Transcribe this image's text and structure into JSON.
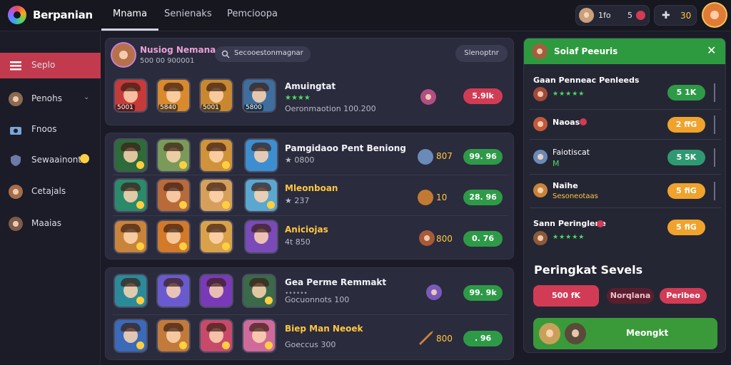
{
  "header": {
    "brand": "Berpanian",
    "tabs": [
      "Mnama",
      "Senienaks",
      "Pemcioopa"
    ],
    "profile_pill": {
      "left": "1fo",
      "right": "5"
    },
    "coins": "30"
  },
  "sidebar": {
    "items": [
      {
        "label": "Seplo"
      },
      {
        "label": "Penohs"
      },
      {
        "label": "Fnoos"
      },
      {
        "label": "Sewaainont"
      },
      {
        "label": "Cetajals"
      },
      {
        "label": "Maaias"
      }
    ]
  },
  "top_panel": {
    "name": "Nusiog Nemana",
    "sub": "500 00 900001",
    "search_placeholder": "Secooestonmagnar",
    "sort_label": "Slenoptnr",
    "tiles": [
      "5001",
      "5840",
      "5001",
      "5800"
    ],
    "item_title": "Amuingtat",
    "item_sub": "Oeronmaotion 100.200",
    "price": "5.9lk"
  },
  "mid_panel": {
    "rows": [
      {
        "title": "Pamgidaoo Pent Beniong",
        "sub": "0800",
        "coin": "807",
        "price": "99. 96"
      },
      {
        "title": "Mleonboan",
        "sub": "237",
        "coin": "10",
        "price": "28. 96"
      },
      {
        "title": "Aniciojas",
        "sub": "4t 850",
        "coin": "800",
        "price": "0. 76"
      }
    ]
  },
  "bot_panel": {
    "rows": [
      {
        "title": "Gea Perme Remmakt",
        "sub": "Gocuonnots 100",
        "price": "99. 9k"
      },
      {
        "title": "Biep Man Neoek",
        "sub": "Goeccus 300",
        "coin": "800",
        "price": ". 96"
      }
    ]
  },
  "right_panel": {
    "title": "Soiaf Peeuris",
    "items": [
      {
        "name": "Gaan Penneac Penleeds",
        "btn": "5 1K",
        "kind": "green"
      },
      {
        "name": "Naoas",
        "btn": "2 ffG",
        "kind": "orange"
      },
      {
        "name": "Faiotiscat",
        "sub": "M",
        "btn": "5 5K",
        "kind": "teal"
      },
      {
        "name": "Naihe",
        "sub": "Sesoneotaas",
        "btn": "5 fiG",
        "kind": "orange"
      },
      {
        "name": "Sann Peringlene",
        "btn": "5 fiG",
        "kind": "orange"
      }
    ],
    "section_title": "Peringkat Sevels",
    "chips": [
      "500 fK",
      "Norqlana",
      "Peribeo"
    ],
    "cta": "Meongkt"
  },
  "colors": {
    "accent": "#c23a4e",
    "green": "#2e9a48",
    "orange": "#f0a32c",
    "bg": "#1a1b26"
  }
}
